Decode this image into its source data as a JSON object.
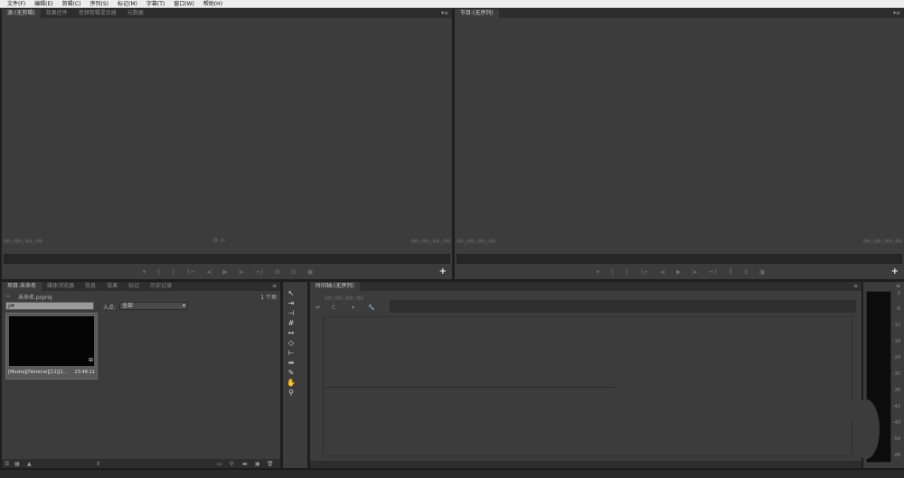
{
  "menu": [
    "文件(F)",
    "编辑(E)",
    "剪辑(C)",
    "序列(S)",
    "标记(M)",
    "字幕(T)",
    "窗口(W)",
    "帮助(H)"
  ],
  "source": {
    "tabs": [
      "源:(无剪辑)",
      "效果控件",
      "音频剪辑混合器",
      "元数据"
    ],
    "timecode_left": "00;00;00;00",
    "timecode_right": "00;00;00;00"
  },
  "program": {
    "tab": "节目:(无序列)",
    "timecode_left": "00;00;00;00",
    "timecode_right": "00;00;00;00"
  },
  "project": {
    "tabs": [
      "项目:未命名",
      "媒体浏览器",
      "信息",
      "效果",
      "标记",
      "历史记录"
    ],
    "item_count": "1 个项",
    "file": "未命名.prproj",
    "in_label": "入点:",
    "in_value": "全部",
    "search_placeholder": "ρ▾",
    "clip": {
      "name": "[Mosha][Fahrenal][12][1...",
      "duration": "23:48:11"
    }
  },
  "timeline": {
    "tab": "时间轴:(无序列)",
    "timecode": "00;00;00;00"
  },
  "meter": {
    "scale": [
      "0",
      "-6",
      "-12",
      "-18",
      "-24",
      "-30",
      "-36",
      "-42",
      "-48",
      "-54",
      "dB"
    ]
  },
  "icons": {
    "tools": [
      "selection-tool-icon",
      "track-select-tool-icon",
      "ripple-edit-tool-icon",
      "rolling-edit-tool-icon",
      "rate-stretch-tool-icon",
      "razor-tool-icon",
      "slip-tool-icon",
      "slide-tool-icon",
      "pen-tool-icon",
      "hand-tool-icon",
      "zoom-tool-icon"
    ]
  }
}
